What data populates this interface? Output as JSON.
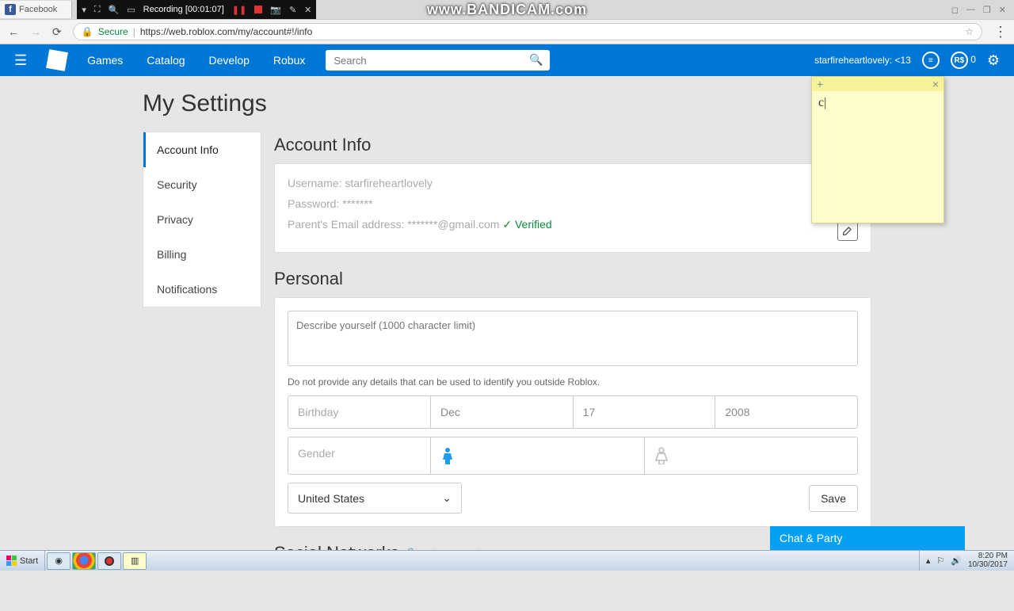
{
  "browser": {
    "fb_tab": "Facebook",
    "recorder_text": "Recording [00:01:07]",
    "watermark": "www.BANDICAM.com",
    "secure_label": "Secure",
    "url": "https://web.roblox.com/my/account#!/info"
  },
  "header": {
    "nav": {
      "games": "Games",
      "catalog": "Catalog",
      "develop": "Develop",
      "robux": "Robux"
    },
    "search_placeholder": "Search",
    "username": "starfireheartlovely",
    "age_tag": "<13",
    "robux": "0"
  },
  "sticky": {
    "text": "c"
  },
  "page_title": "My Settings",
  "side_nav": {
    "account": "Account Info",
    "security": "Security",
    "privacy": "Privacy",
    "billing": "Billing",
    "notifications": "Notifications"
  },
  "account_section": {
    "heading": "Account Info",
    "username_label": "Username:",
    "username_value": "starfireheartlovely",
    "password_label": "Password:",
    "password_value": "*******",
    "email_label": "Parent's Email address:",
    "email_value": "*******@gmail.com",
    "verified": "Verified"
  },
  "personal_section": {
    "heading": "Personal",
    "describe_placeholder": "Describe yourself (1000 character limit)",
    "hint": "Do not provide any details that can be used to identify you outside Roblox.",
    "birthday_label": "Birthday",
    "month": "Dec",
    "day": "17",
    "year": "2008",
    "gender_label": "Gender",
    "country": "United States",
    "save": "Save"
  },
  "social_section": {
    "heading": "Social Networks",
    "privacy_mode": "Privacy Mode"
  },
  "chat_bar": "Chat & Party",
  "taskbar": {
    "start": "Start",
    "time": "8:20 PM",
    "date": "10/30/2017"
  }
}
